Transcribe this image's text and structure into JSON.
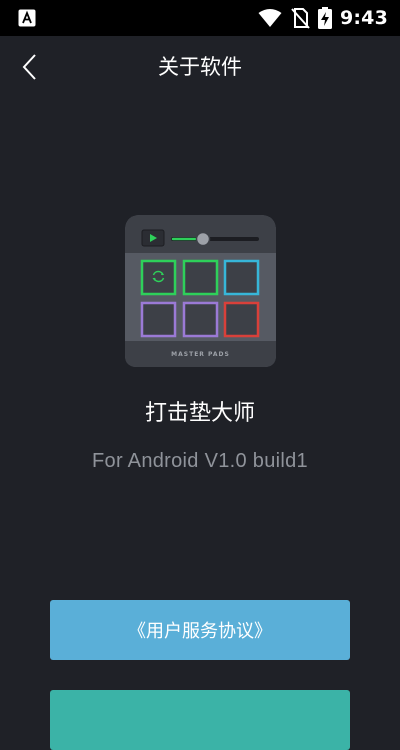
{
  "status_bar": {
    "time": "9:43",
    "left_icon": "font-a-icon",
    "icons": [
      "wifi-icon",
      "no-sim-icon",
      "battery-charging-icon"
    ]
  },
  "header": {
    "title": "关于软件",
    "back_icon": "chevron-left-icon"
  },
  "app": {
    "logo_label": "MASTER PADS",
    "name": "打击垫大师",
    "version": "For Android V1.0 build1"
  },
  "buttons": {
    "agreement_label": "《用户服务协议》"
  },
  "colors": {
    "background": "#1f2127",
    "status_bar": "#000000",
    "primary_button": "#5aafd8",
    "secondary_button": "#3bb3a7",
    "version_text": "#8f939a",
    "pad_green": "#2ed05a",
    "pad_cyan": "#37b6d9",
    "pad_purple": "#9b7ad6",
    "pad_red": "#d9403a"
  }
}
